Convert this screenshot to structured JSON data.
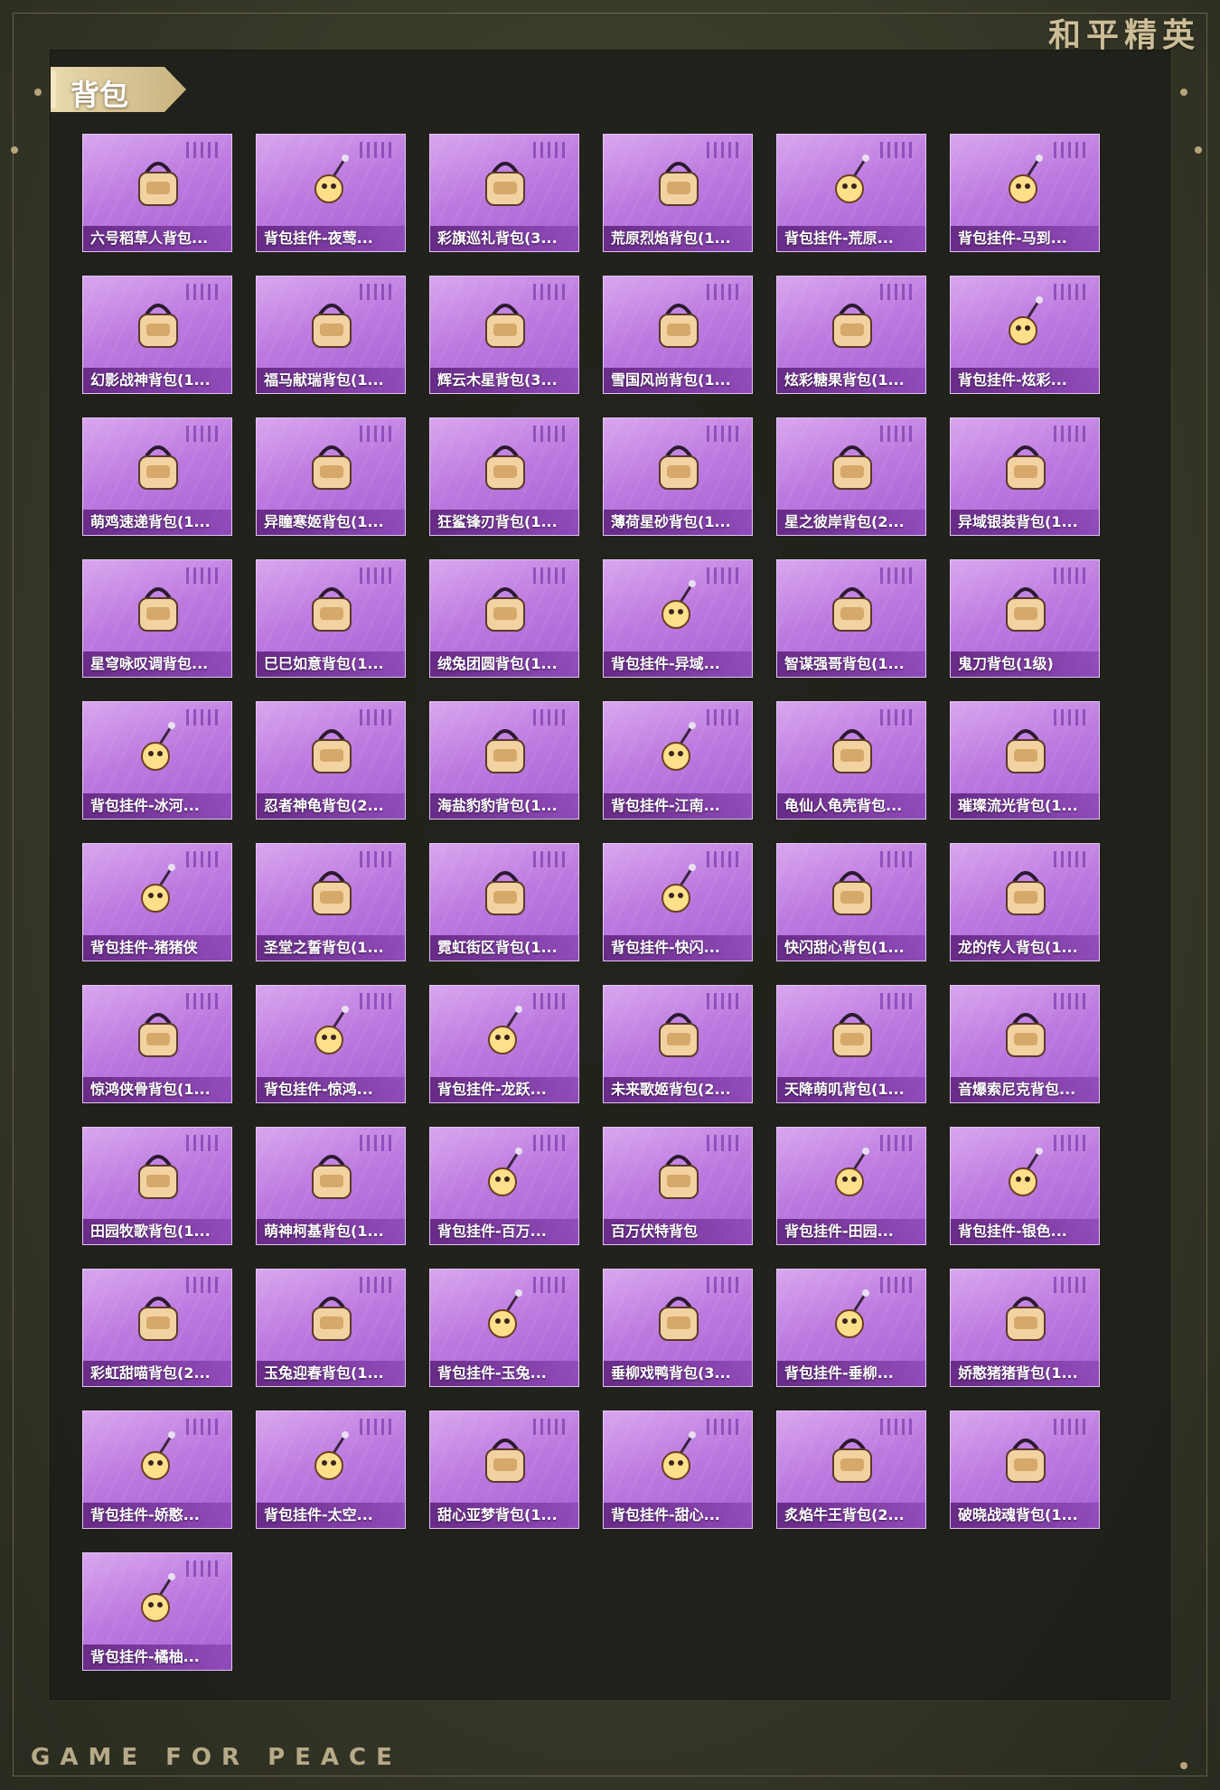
{
  "brand": {
    "title_cn": "和平精英",
    "footer": "GAME FOR PEACE"
  },
  "section": {
    "title": "背包"
  },
  "colors": {
    "card_gradient_top": "#d9a6ee",
    "card_gradient_bottom": "#a45fd2",
    "caption_bar": "#5a1e78",
    "tab_gold": "#c8b27f"
  },
  "items": [
    {
      "label": "六号稻草人背包...",
      "icon": "backpack-icon"
    },
    {
      "label": "背包挂件-夜莺...",
      "icon": "charm-icon"
    },
    {
      "label": "彩旗巡礼背包(3...",
      "icon": "backpack-icon"
    },
    {
      "label": "荒原烈焰背包(1...",
      "icon": "backpack-icon"
    },
    {
      "label": "背包挂件-荒原...",
      "icon": "charm-icon"
    },
    {
      "label": "背包挂件-马到...",
      "icon": "charm-icon"
    },
    {
      "label": "幻影战神背包(1...",
      "icon": "backpack-icon"
    },
    {
      "label": "福马献瑞背包(1...",
      "icon": "backpack-icon"
    },
    {
      "label": "辉云木星背包(3...",
      "icon": "backpack-icon"
    },
    {
      "label": "雪国风尚背包(1...",
      "icon": "backpack-icon"
    },
    {
      "label": "炫彩糖果背包(1...",
      "icon": "backpack-icon"
    },
    {
      "label": "背包挂件-炫彩...",
      "icon": "charm-icon"
    },
    {
      "label": "萌鸡速递背包(1...",
      "icon": "backpack-icon"
    },
    {
      "label": "异瞳寒姬背包(1...",
      "icon": "backpack-icon"
    },
    {
      "label": "狂鲨锋刃背包(1...",
      "icon": "backpack-icon"
    },
    {
      "label": "薄荷星砂背包(1...",
      "icon": "backpack-icon"
    },
    {
      "label": "星之彼岸背包(2...",
      "icon": "backpack-icon"
    },
    {
      "label": "异域银装背包(1...",
      "icon": "backpack-icon"
    },
    {
      "label": "星穹咏叹调背包...",
      "icon": "backpack-icon"
    },
    {
      "label": "巳巳如意背包(1...",
      "icon": "backpack-icon"
    },
    {
      "label": "绒兔团圆背包(1...",
      "icon": "backpack-icon"
    },
    {
      "label": "背包挂件-异域...",
      "icon": "charm-icon"
    },
    {
      "label": "智谋强哥背包(1...",
      "icon": "backpack-icon"
    },
    {
      "label": "鬼刀背包(1级)",
      "icon": "backpack-icon"
    },
    {
      "label": "背包挂件-冰河...",
      "icon": "charm-icon"
    },
    {
      "label": "忍者神龟背包(2...",
      "icon": "backpack-icon"
    },
    {
      "label": "海盐豹豹背包(1...",
      "icon": "backpack-icon"
    },
    {
      "label": "背包挂件-江南...",
      "icon": "charm-icon"
    },
    {
      "label": "龟仙人龟壳背包...",
      "icon": "backpack-icon"
    },
    {
      "label": "璀璨流光背包(1...",
      "icon": "backpack-icon"
    },
    {
      "label": "背包挂件-猪猪侠",
      "icon": "charm-icon"
    },
    {
      "label": "圣堂之誓背包(1...",
      "icon": "backpack-icon"
    },
    {
      "label": "霓虹街区背包(1...",
      "icon": "backpack-icon"
    },
    {
      "label": "背包挂件-快闪...",
      "icon": "charm-icon"
    },
    {
      "label": "快闪甜心背包(1...",
      "icon": "backpack-icon"
    },
    {
      "label": "龙的传人背包(1...",
      "icon": "backpack-icon"
    },
    {
      "label": "惊鸿侠骨背包(1...",
      "icon": "backpack-icon"
    },
    {
      "label": "背包挂件-惊鸿...",
      "icon": "charm-icon"
    },
    {
      "label": "背包挂件-龙跃...",
      "icon": "charm-icon"
    },
    {
      "label": "未来歌姬背包(2...",
      "icon": "backpack-icon"
    },
    {
      "label": "天降萌叽背包(1...",
      "icon": "backpack-icon"
    },
    {
      "label": "音爆索尼克背包...",
      "icon": "backpack-icon"
    },
    {
      "label": "田园牧歌背包(1...",
      "icon": "backpack-icon"
    },
    {
      "label": "萌神柯基背包(1...",
      "icon": "backpack-icon"
    },
    {
      "label": "背包挂件-百万...",
      "icon": "charm-icon"
    },
    {
      "label": "百万伏特背包",
      "icon": "backpack-icon"
    },
    {
      "label": "背包挂件-田园...",
      "icon": "charm-icon"
    },
    {
      "label": "背包挂件-银色...",
      "icon": "charm-icon"
    },
    {
      "label": "彩虹甜喵背包(2...",
      "icon": "backpack-icon"
    },
    {
      "label": "玉兔迎春背包(1...",
      "icon": "backpack-icon"
    },
    {
      "label": "背包挂件-玉兔...",
      "icon": "charm-icon"
    },
    {
      "label": "垂柳戏鸭背包(3...",
      "icon": "backpack-icon"
    },
    {
      "label": "背包挂件-垂柳...",
      "icon": "charm-icon"
    },
    {
      "label": "娇憨猪猪背包(1...",
      "icon": "backpack-icon"
    },
    {
      "label": "背包挂件-娇憨...",
      "icon": "charm-icon"
    },
    {
      "label": "背包挂件-太空...",
      "icon": "charm-icon"
    },
    {
      "label": "甜心亚梦背包(1...",
      "icon": "backpack-icon"
    },
    {
      "label": "背包挂件-甜心...",
      "icon": "charm-icon"
    },
    {
      "label": "炙焰牛王背包(2...",
      "icon": "backpack-icon"
    },
    {
      "label": "破晓战魂背包(1...",
      "icon": "backpack-icon"
    },
    {
      "label": "背包挂件-橘柚...",
      "icon": "charm-icon"
    }
  ]
}
